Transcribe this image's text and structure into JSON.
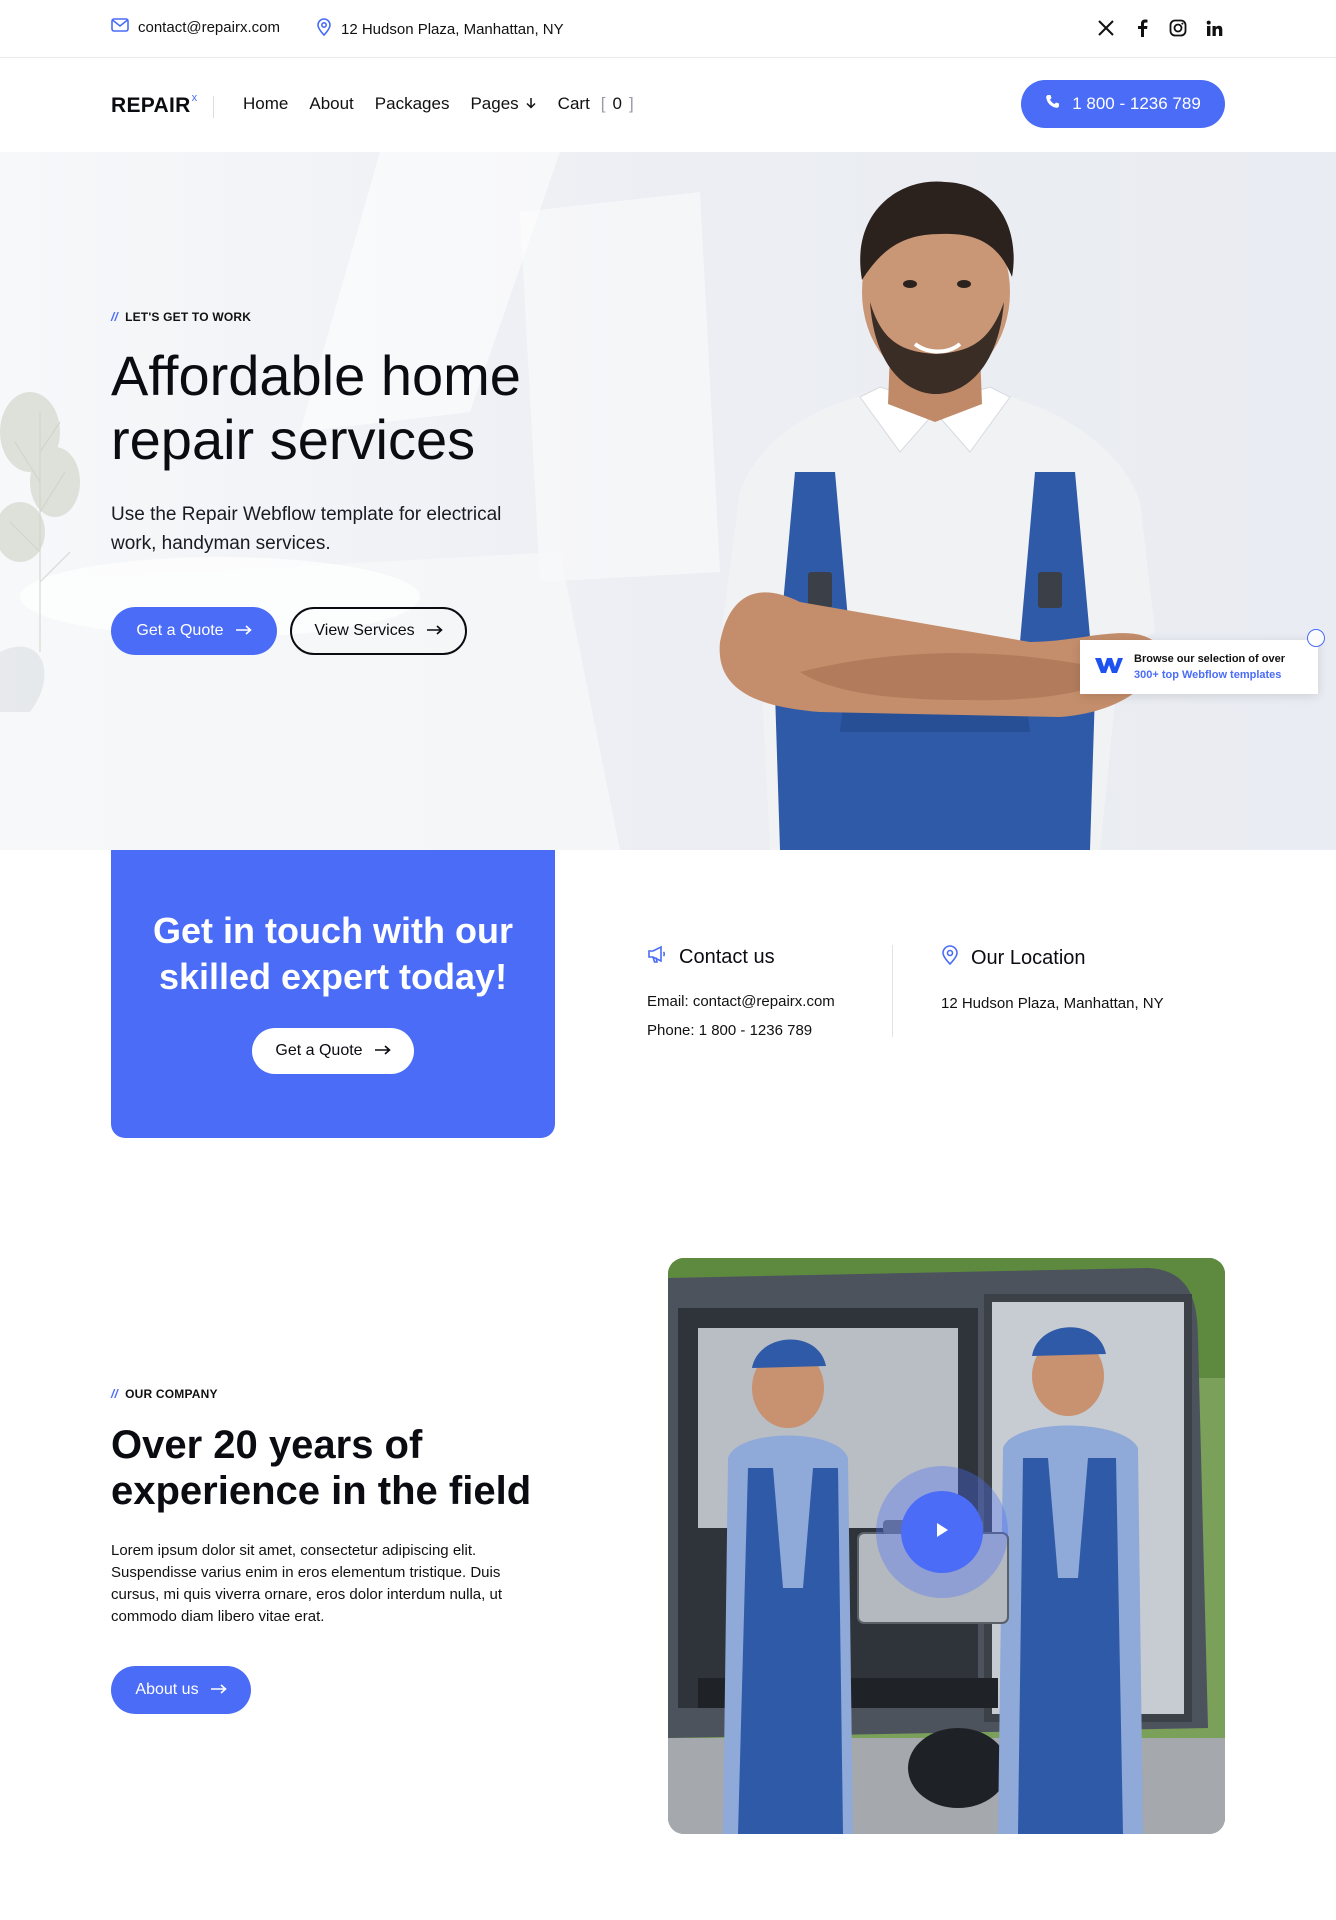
{
  "topbar": {
    "email": "contact@repairx.com",
    "location": "12 Hudson Plaza, Manhattan, NY",
    "socials": [
      "x-icon",
      "facebook-icon",
      "instagram-icon",
      "linkedin-icon"
    ]
  },
  "nav": {
    "logo": "REPAIR",
    "logo_mark": "x",
    "links": [
      "Home",
      "About",
      "Packages",
      "Pages"
    ],
    "cart_label": "Cart",
    "cart_count": "0",
    "phone": "1 800 - 1236 789"
  },
  "hero": {
    "eyebrow": "LET'S GET TO WORK",
    "title": "Affordable home repair services",
    "subtitle": "Use the Repair Webflow template for electrical work, handyman services.",
    "primary_cta": "Get a Quote",
    "secondary_cta": "View Services",
    "badge_line1": "Browse our selection of over",
    "badge_line2": "300+ top Webflow templates"
  },
  "contact": {
    "cta_title": "Get in touch with our skilled expert today!",
    "cta_button": "Get a Quote",
    "contact_heading": "Contact us",
    "email_line": "Email: contact@repairx.com",
    "phone_line": "Phone: 1 800 - 1236 789",
    "location_heading": "Our Location",
    "location_line": "12 Hudson Plaza, Manhattan, NY"
  },
  "company": {
    "eyebrow": "OUR COMPANY",
    "title": "Over 20 years of experience in the field",
    "body": "Lorem ipsum dolor sit amet, consectetur adipiscing elit. Suspendisse varius enim in eros elementum tristique. Duis cursus, mi quis viverra ornare, eros dolor interdum nulla, ut commodo diam libero vitae erat.",
    "button": "About us"
  },
  "colors": {
    "accent": "#4a6cf7",
    "text": "#0b0b12"
  }
}
